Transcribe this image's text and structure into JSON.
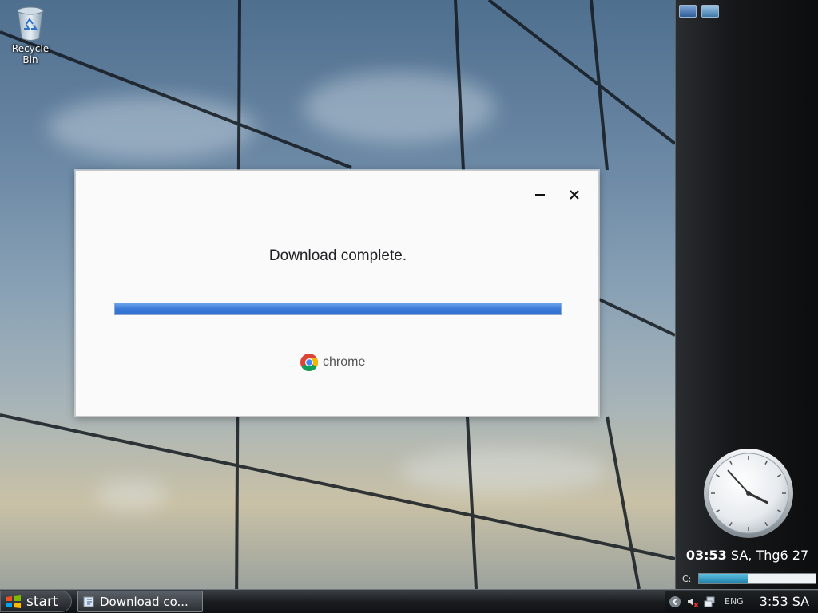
{
  "desktop": {
    "icons": [
      {
        "label": "Recycle Bin",
        "icon": "recycle-bin-icon"
      }
    ]
  },
  "dialog": {
    "title": "Download complete.",
    "progress_fraction": 1.0,
    "brand_label": "chrome",
    "brand_icon": "chrome-logo-icon",
    "minimize_symbol": "−",
    "close_symbol": "✕"
  },
  "sidebar": {
    "clock_hour": 3,
    "clock_minute": 53,
    "date_time": "03:53",
    "date_rest": " SA, Thg6 27",
    "drive_label": "C:",
    "drive_fraction": 0.42
  },
  "taskbar": {
    "start_label": "start",
    "window_button_label": "Download co...",
    "tray_language": "ENG",
    "tray_time": "3:53 SA"
  },
  "colors": {
    "progress_fill": "#3a7ad8",
    "chrome_red": "#db4437",
    "chrome_yellow": "#f4b400",
    "chrome_green": "#0f9d58",
    "chrome_blue": "#4285f4"
  }
}
